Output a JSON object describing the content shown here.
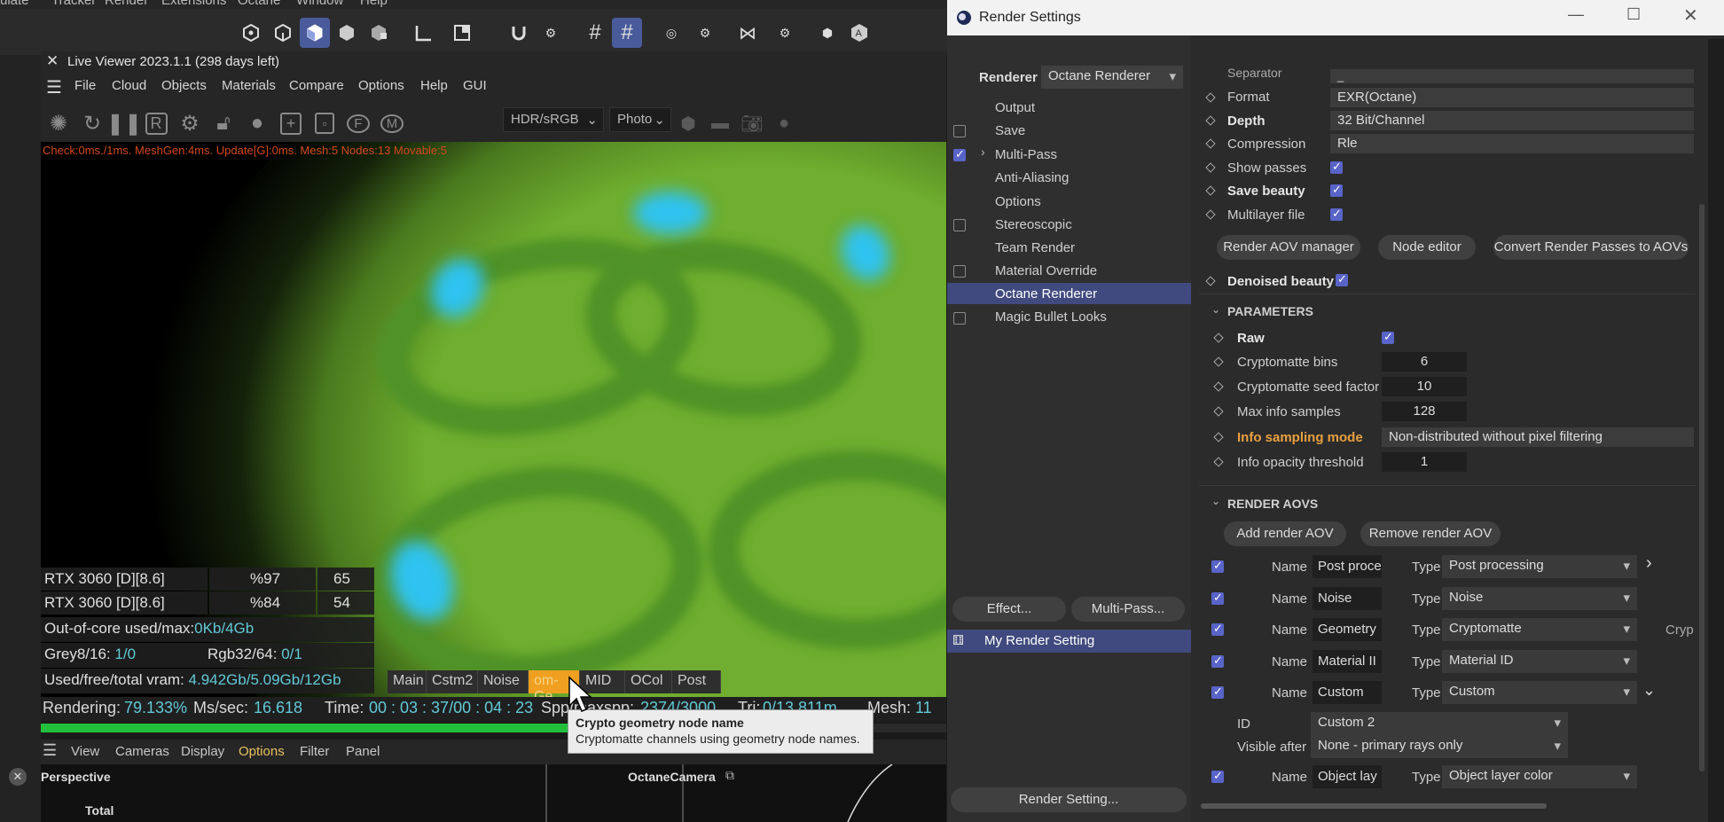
{
  "c4d_menu": [
    "ulate",
    "Tracker",
    "Render",
    "Extensions",
    "Octane",
    "Window",
    "Help"
  ],
  "live_viewer": {
    "title": "Live Viewer 2023.1.1 (298 days left)",
    "menu": [
      "File",
      "Cloud",
      "Objects",
      "Materials",
      "Compare",
      "Options",
      "Help",
      "GUI"
    ],
    "colorspace": "HDR/sRGB",
    "mode": "Photo",
    "stats_line": "Check:0ms./1ms. MeshGen:4ms. Update[G]:0ms. Mesh:5 Nodes:13 Movable:5",
    "gpus": [
      {
        "name": "RTX 3060 [D][8.6]",
        "pct": "%97",
        "temp": "65"
      },
      {
        "name": "RTX 3060 [D][8.6]",
        "pct": "%84",
        "temp": "54"
      }
    ],
    "out_of_core_label": "Out-of-core used/max:",
    "out_of_core_value": "0Kb/4Gb",
    "grey_label": "Grey8/16:",
    "grey_value": "1/0",
    "rgb_label": "Rgb32/64:",
    "rgb_value": "0/1",
    "vram_label": "Used/free/total vram:",
    "vram_value": "4.942Gb/5.09Gb/12Gb",
    "channels": [
      "Main",
      "Cstm2",
      "Noise",
      "om-Ge",
      "MID",
      "OCol",
      "Post"
    ],
    "selected_channel": "om-Ge",
    "status": {
      "rendering_label": "Rendering:",
      "rendering_value": "79.133%",
      "mssec_label": "Ms/sec:",
      "mssec_value": "16.618",
      "time_label": "Time:",
      "time_value": "00 : 03 : 37/00 : 04 : 23",
      "spp_label": "Spp/maxspp:",
      "spp_value": "2374/3000",
      "tri_label": "Tri:",
      "tri_value": "0/13.811m",
      "mesh_label": "Mesh:",
      "mesh_value": "11"
    },
    "progress": 0.79133,
    "tooltip_title": "Crypto geometry node name",
    "tooltip_text": "Cryptomatte channels using geometry node names."
  },
  "viewport": {
    "menu": [
      "View",
      "Cameras",
      "Display",
      "Options",
      "Filter",
      "Panel"
    ],
    "active_menu": "Options",
    "label": "Perspective",
    "camera": "OctaneCamera",
    "total_label": "Total"
  },
  "render_settings": {
    "title": "Render Settings",
    "renderer_label": "Renderer",
    "renderer_value": "Octane Renderer",
    "left_items": [
      {
        "label": "Output",
        "checkbox": false,
        "checked": false
      },
      {
        "label": "Save",
        "checkbox": true,
        "checked": false
      },
      {
        "label": "Multi-Pass",
        "checkbox": true,
        "checked": true
      },
      {
        "label": "Anti-Aliasing",
        "checkbox": false,
        "checked": false
      },
      {
        "label": "Options",
        "checkbox": false,
        "checked": false
      },
      {
        "label": "Stereoscopic",
        "checkbox": true,
        "checked": false
      },
      {
        "label": "Team Render",
        "checkbox": false,
        "checked": false
      },
      {
        "label": "Material Override",
        "checkbox": true,
        "checked": false
      },
      {
        "label": "Octane Renderer",
        "checkbox": false,
        "checked": false
      },
      {
        "label": "Magic Bullet Looks",
        "checkbox": true,
        "checked": false
      }
    ],
    "effect_button": "Effect...",
    "multipass_button": "Multi-Pass...",
    "setting_name": "My Render Setting",
    "render_setting_button": "Render Setting...",
    "separator_label": "Separator",
    "separator_value": "_",
    "format_label": "Format",
    "format_value": "EXR(Octane)",
    "depth_label": "Depth",
    "depth_value": "32 Bit/Channel",
    "compression_label": "Compression",
    "compression_value": "Rle",
    "show_passes_label": "Show passes",
    "save_beauty_label": "Save beauty",
    "multilayer_label": "Multilayer file",
    "aov_manager_button": "Render AOV manager",
    "node_editor_button": "Node editor",
    "convert_button": "Convert Render Passes to AOVs",
    "denoised_label": "Denoised beauty",
    "parameters_header": "PARAMETERS",
    "raw_label": "Raw",
    "crypto_bins_label": "Cryptomatte bins",
    "crypto_bins_value": "6",
    "crypto_seed_label": "Cryptomatte seed factor",
    "crypto_seed_value": "10",
    "max_info_label": "Max info samples",
    "max_info_value": "128",
    "info_mode_label": "Info sampling mode",
    "info_mode_value": "Non-distributed without pixel filtering",
    "info_opacity_label": "Info opacity threshold",
    "info_opacity_value": "1",
    "aovs_header": "RENDER AOVS",
    "add_aov_button": "Add render AOV",
    "remove_aov_button": "Remove render AOV",
    "name_label": "Name",
    "type_label": "Type",
    "aovs": [
      {
        "name": "Post proce",
        "type": "Post processing"
      },
      {
        "name": "Noise",
        "type": "Noise"
      },
      {
        "name": "Geometry",
        "type": "Cryptomatte"
      },
      {
        "name": "Material II",
        "type": "Material ID"
      },
      {
        "name": "Custom",
        "type": "Custom"
      }
    ],
    "crypto_overflow": "Cryp",
    "id_label": "ID",
    "id_value": "Custom 2",
    "visible_after_label": "Visible after",
    "visible_after_value": "None - primary rays only",
    "last_aov_name": "Object lay",
    "last_aov_type": "Object layer color"
  }
}
